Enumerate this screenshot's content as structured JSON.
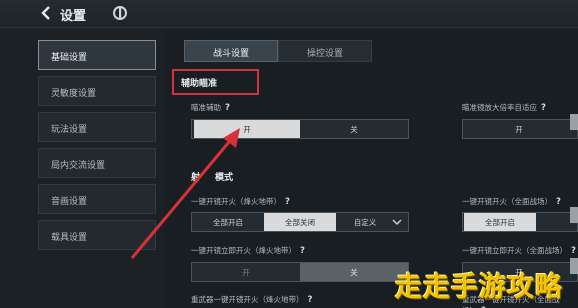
{
  "header": {
    "title": "设置"
  },
  "sidebar": {
    "items": [
      {
        "label": "基础设置"
      },
      {
        "label": "灵敏度设置"
      },
      {
        "label": "玩法设置"
      },
      {
        "label": "局内交流设置"
      },
      {
        "label": "音画设置"
      },
      {
        "label": "载具设置"
      }
    ]
  },
  "tabs": [
    {
      "label": "战斗设置"
    },
    {
      "label": "操控设置"
    }
  ],
  "aim_assist": {
    "section_title": "辅助瞄准",
    "assist": {
      "label": "瞄准辅助",
      "help": "?",
      "on": "开",
      "off": "关"
    },
    "scope_assist": {
      "label": "瞄准镜放大倍率自适应",
      "help": "?",
      "on": "开"
    }
  },
  "fire_mode": {
    "section_title": "射击模式",
    "title_visible": "射",
    "title_visible_end": "模式",
    "one_tap_beacon": {
      "label": "一键开镜开火（烽火地带）",
      "help": "?",
      "opts": [
        "全部开启",
        "全部关闭",
        "自定义"
      ]
    },
    "one_tap_battlefield": {
      "label": "一键开镜开火（全面战场）",
      "help": "?",
      "opts": [
        "全部开启"
      ]
    },
    "instant_beacon": {
      "label": "一键开镜立即开火（烽火地带）",
      "help": "?",
      "opts": [
        "开",
        "关"
      ]
    },
    "instant_battlefield": {
      "label": "一键开镜立即开火（全面战场）",
      "help": "?",
      "opts": [
        "开"
      ]
    },
    "heavy_weapon": {
      "label": "重武器一键开镜开火（烽火地带）",
      "help": "?"
    },
    "heavy_weapon_right": {
      "label": "重武器一键开镜开火（全面战场）",
      "help": "?"
    }
  },
  "watermark": "走走手游攻略",
  "colors": {
    "highlight": "#d7313a",
    "watermark": "#f2c400",
    "active_option": "#d8dadc"
  }
}
